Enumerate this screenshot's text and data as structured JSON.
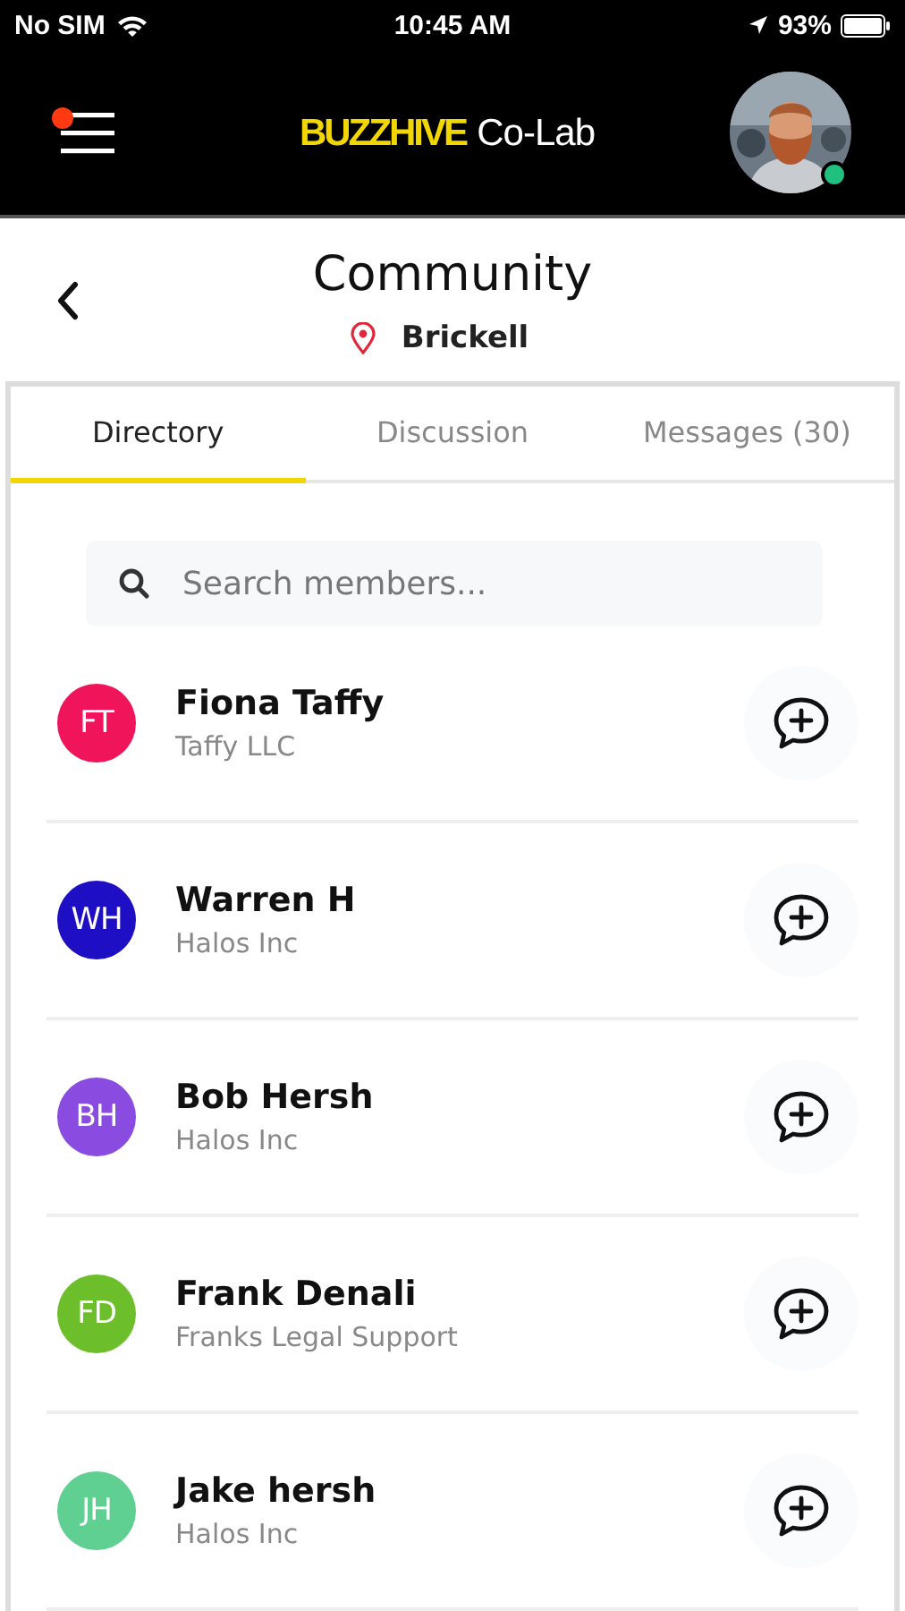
{
  "status_bar": {
    "carrier": "No SIM",
    "time": "10:45 AM",
    "battery": "93%"
  },
  "header": {
    "logo_brand": "BUZZHIVE",
    "logo_suffix": "Co-Lab",
    "menu_notification": true,
    "user_online": true
  },
  "page": {
    "title": "Community",
    "location": "Brickell"
  },
  "tabs": [
    {
      "label": "Directory",
      "selected": true
    },
    {
      "label": "Discussion",
      "selected": false
    },
    {
      "label": "Messages (30)",
      "selected": false
    }
  ],
  "search": {
    "placeholder": "Search members..."
  },
  "members": [
    {
      "initials": "FT",
      "name": "Fiona Taffy",
      "company": "Taffy LLC",
      "color": "#f0145a"
    },
    {
      "initials": "WH",
      "name": "Warren H",
      "company": "Halos Inc",
      "color": "#1f0fc4"
    },
    {
      "initials": "BH",
      "name": "Bob Hersh",
      "company": "Halos Inc",
      "color": "#8a4be0"
    },
    {
      "initials": "FD",
      "name": "Frank Denali",
      "company": "Franks Legal Support",
      "color": "#6cbf2a"
    },
    {
      "initials": "JH",
      "name": "Jake hersh",
      "company": "Halos Inc",
      "color": "#5fcf92"
    }
  ]
}
